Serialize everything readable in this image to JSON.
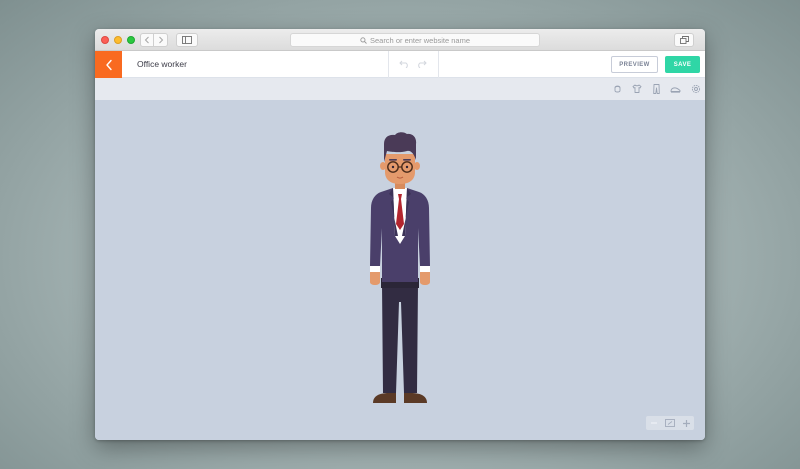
{
  "browser": {
    "url_placeholder": "Search or enter website name"
  },
  "editor": {
    "title": "Office worker",
    "preview_label": "PREVIEW",
    "save_label": "SAVE",
    "accent_color": "#f96a20",
    "save_color": "#2fd6a6"
  },
  "subtoolbar": {
    "icons": [
      "head-icon",
      "shirt-icon",
      "pants-icon",
      "shoe-icon",
      "settings-icon"
    ]
  },
  "zoom_controls": {
    "icons": [
      "zoom-out-icon",
      "fit-screen-icon",
      "zoom-in-icon"
    ]
  }
}
